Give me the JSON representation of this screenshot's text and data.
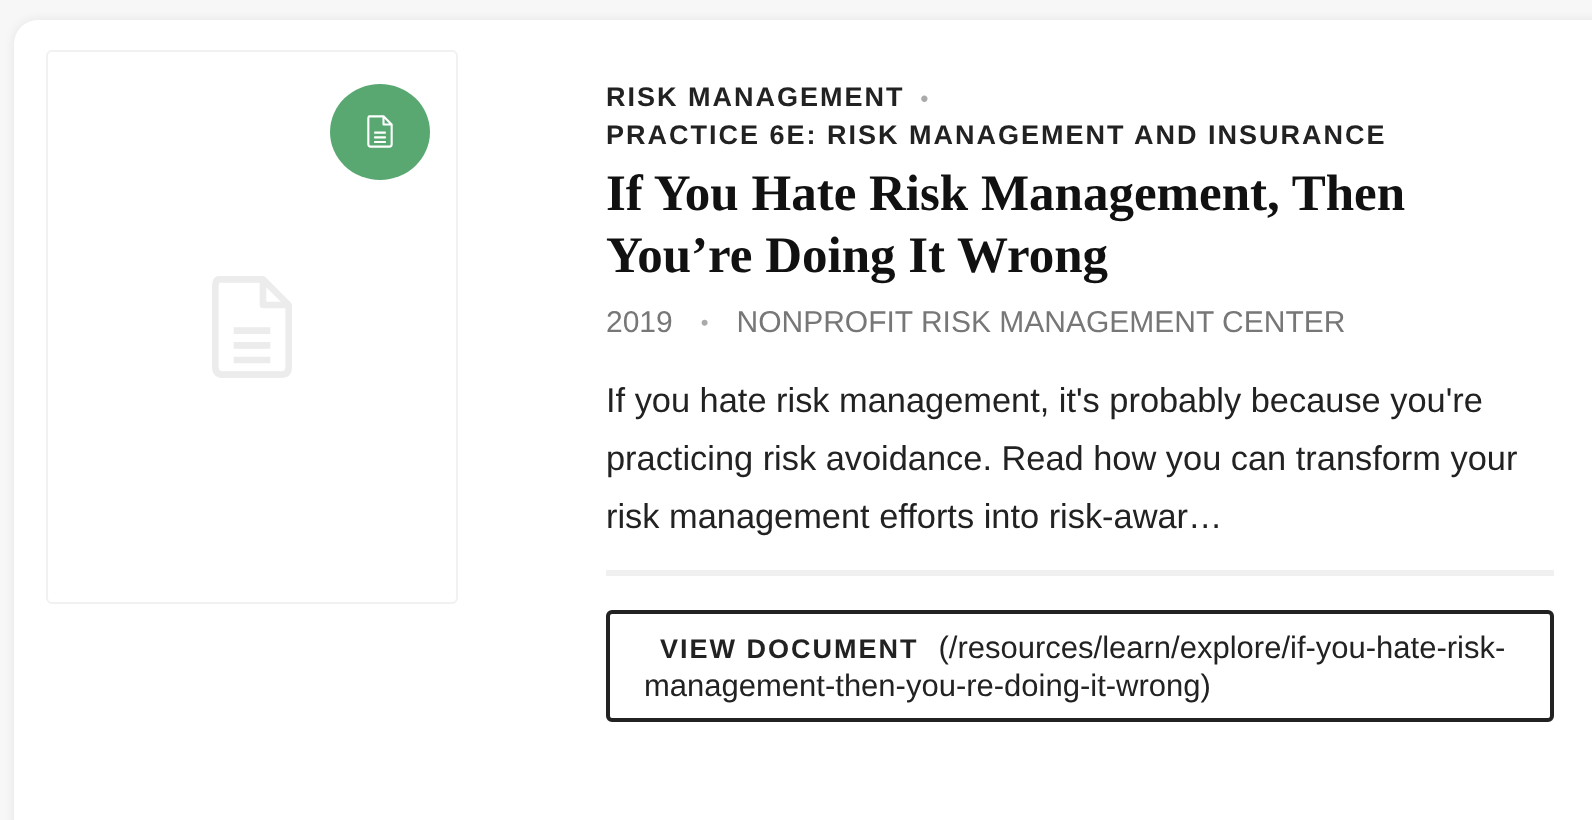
{
  "card": {
    "badge": {
      "kind": "document"
    },
    "category": "RISK MANAGEMENT",
    "separator": "•",
    "subcategory": "PRACTICE 6E: RISK MANAGEMENT AND INSURANCE",
    "title": "If You Hate Risk Management, Then You’re Doing It Wrong",
    "year": "2019",
    "meta_separator": "•",
    "source": "NONPROFIT RISK MANAGEMENT CENTER",
    "description": "If you hate risk management, it's probably because you're practicing risk avoidance. Read how you can transform your risk management efforts into risk-awar…",
    "button": {
      "label": "VIEW DOCUMENT",
      "url": "(/resources/learn/explore/if-you-hate-risk-management-then-you-re-doing-it-wrong)"
    }
  }
}
